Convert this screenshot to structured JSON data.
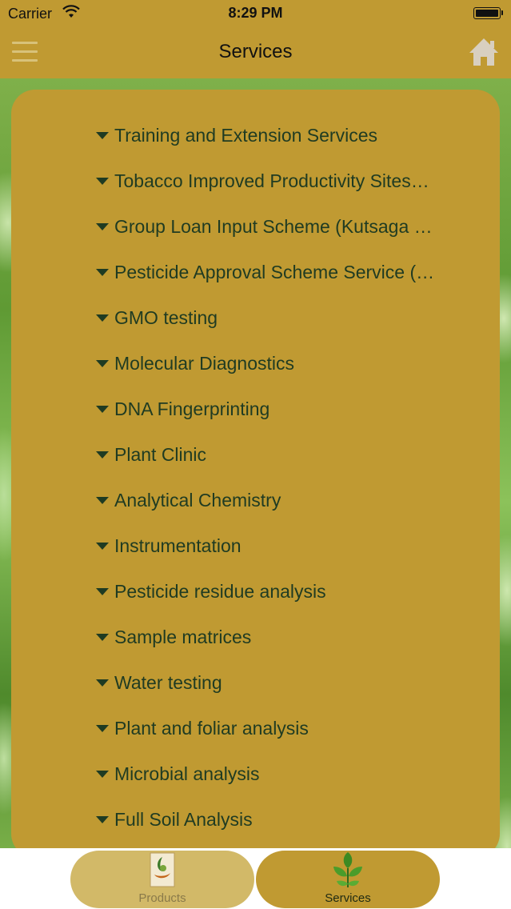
{
  "status_bar": {
    "carrier": "Carrier",
    "time": "8:29 PM"
  },
  "nav": {
    "title": "Services",
    "menu_icon": "hamburger-menu-icon",
    "home_icon": "home-icon"
  },
  "services": [
    "Training and Extension Services",
    "Tobacco Improved Productivity Sites…",
    "Group Loan Input Scheme (Kutsaga …",
    "Pesticide Approval Scheme Service (…",
    "GMO testing",
    "Molecular Diagnostics",
    "DNA Fingerprinting",
    "Plant Clinic",
    "Analytical Chemistry",
    "Instrumentation",
    "Pesticide residue analysis",
    "Sample matrices",
    "Water testing",
    "Plant and foliar analysis",
    "Microbial analysis",
    "Full Soil Analysis"
  ],
  "tabs": [
    {
      "label": "Products",
      "icon": "products-leaf-logo-icon",
      "active": false
    },
    {
      "label": "Services",
      "icon": "services-plant-icon",
      "active": true
    }
  ],
  "colors": {
    "bar": "#c09a32",
    "text": "#1f3b22"
  }
}
